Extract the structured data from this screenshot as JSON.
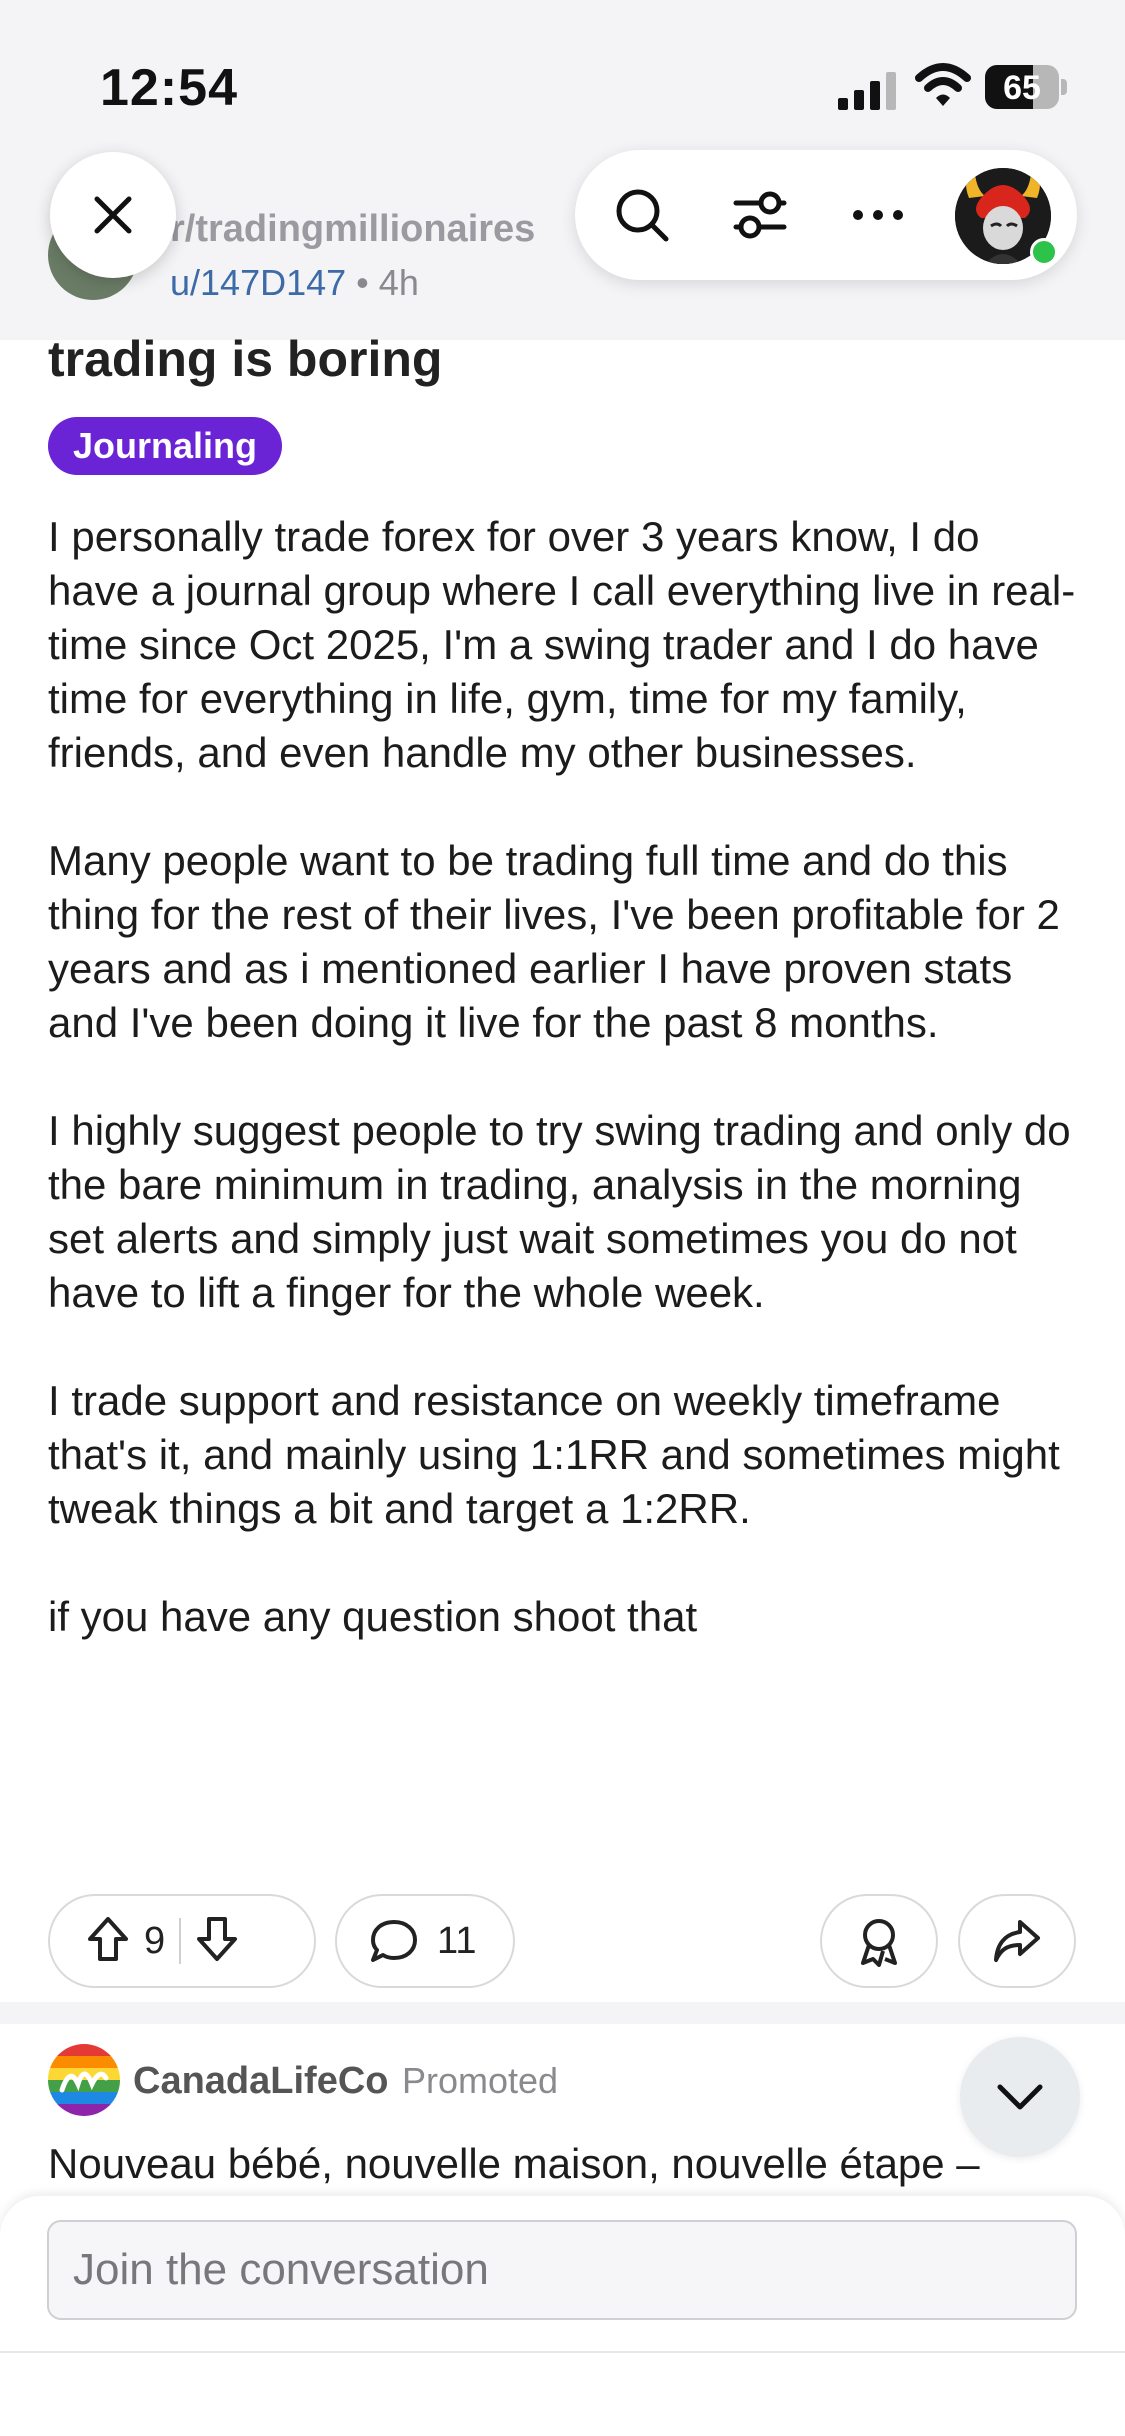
{
  "status": {
    "time": "12:54",
    "battery": "65",
    "battery_level": 0.65
  },
  "header": {
    "subreddit": "r/tradingmillionaires",
    "author": "u/147D147",
    "separator": "•",
    "age": "4h"
  },
  "post": {
    "title": "trading is boring",
    "flair": "Journaling",
    "paragraphs": [
      "I personally trade forex for over 3 years know, I do have a journal group where I call everything live in real-time since Oct 2025, I'm a swing trader and I do have time for everything in life, gym, time for my family, friends, and even handle my other businesses.",
      "Many people want to be trading full time and do this thing for the rest of their lives, I've been profitable for 2 years and as i mentioned earlier I have proven stats and I've been doing it live for the past 8 months.",
      "I highly suggest people to try swing trading and only do the bare minimum in trading, analysis in the morning set alerts and simply just wait sometimes you do not have to lift a finger for the whole week.",
      "I trade support and resistance on weekly timeframe that's it, and mainly using 1:1RR and sometimes might tweak things a bit and target a 1:2RR.",
      "if you have any question shoot that"
    ],
    "upvotes": "9",
    "comments": "11"
  },
  "ad": {
    "name": "CanadaLifeCo",
    "label": "Promoted",
    "text": "Nouveau bébé, nouvelle maison, nouvelle étape –"
  },
  "composer": {
    "placeholder": "Join the conversation"
  },
  "colors": {
    "flair": "#6a24d6",
    "author_link": "#3c6ba8",
    "online": "#2dc24a"
  }
}
